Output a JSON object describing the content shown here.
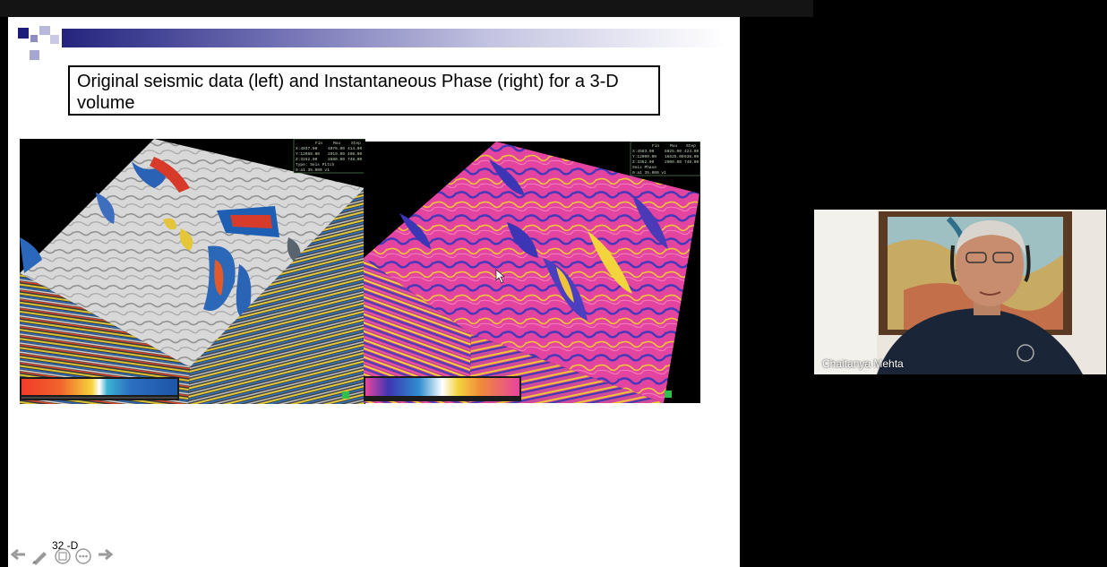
{
  "slide": {
    "title": "Original seismic data (left) and Instantaneous Phase (right)  for a 3-D volume",
    "slide_number": "32 -D"
  },
  "left_panel": {
    "header_cols": [
      "Fin",
      "Mou",
      "Step"
    ],
    "header_rows": [
      [
        "X:4037.00",
        "4076.00",
        "414.00"
      ],
      [
        "Y:12958.00",
        "2019.00",
        "408.00"
      ],
      [
        "Z:3152.00",
        "2880.00",
        "748.00"
      ],
      [
        "Type: Seis Pitch",
        "",
        ""
      ],
      [
        "0:a1 35.000 v1",
        "",
        ""
      ]
    ]
  },
  "right_panel": {
    "header_cols": [
      "Fin",
      "Mou",
      "Step"
    ],
    "header_rows": [
      [
        "X:4583.00",
        "6025.00",
        "424.00"
      ],
      [
        "Y:12000.00",
        "16525.00",
        "538.00"
      ],
      [
        "Z:3352.00",
        "2900.00",
        "748.00"
      ],
      [
        "Seis Phase",
        "",
        ""
      ],
      [
        "0:a1 35.000 v1",
        "",
        ""
      ]
    ]
  },
  "video": {
    "participant_name": "Chaitanya Mehta"
  },
  "controls": [
    "prev-arrow-icon",
    "pen-icon",
    "slides-icon",
    "more-icon",
    "next-arrow-icon"
  ],
  "colors": {
    "title_border": "#000000",
    "deco_square": "#1c1c7a",
    "deco_light": "#9a9acb"
  }
}
